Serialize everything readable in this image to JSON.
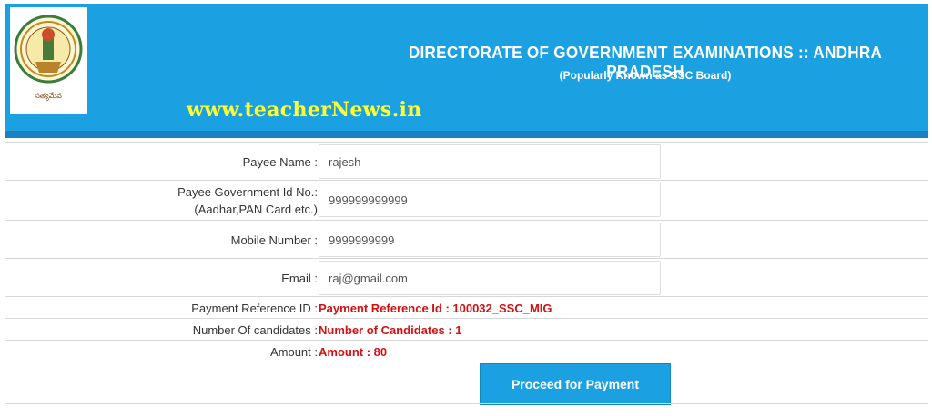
{
  "header": {
    "title": "DIRECTORATE OF GOVERNMENT EXAMINATIONS :: ANDHRA PRADESH",
    "subtitle": "(Popularly Known as SSC Board)",
    "site_watermark": "www.teacherNews.in",
    "logo_caption": "సత్యమేవ జయతే"
  },
  "form": {
    "payee_name": {
      "label": "Payee Name :",
      "value": "rajesh"
    },
    "gov_id": {
      "label_line1": "Payee Government Id No.:",
      "label_line2": "(Aadhar,PAN Card etc.)",
      "value": "999999999999"
    },
    "mobile": {
      "label": "Mobile Number :",
      "value": "9999999999"
    },
    "email": {
      "label": "Email :",
      "value": "raj@gmail.com"
    },
    "reference": {
      "label": "Payment Reference ID :",
      "value": "Payment Reference Id : 100032_SSC_MIG"
    },
    "candidates": {
      "label": "Number Of candidates :",
      "value": "Number of Candidates : 1"
    },
    "amount": {
      "label": "Amount :",
      "value": "Amount : 80"
    }
  },
  "actions": {
    "proceed_label": "Proceed for Payment"
  },
  "colors": {
    "header_bg": "#1ba1e2",
    "accent_red": "#d41111",
    "watermark_yellow": "#ffff33"
  }
}
